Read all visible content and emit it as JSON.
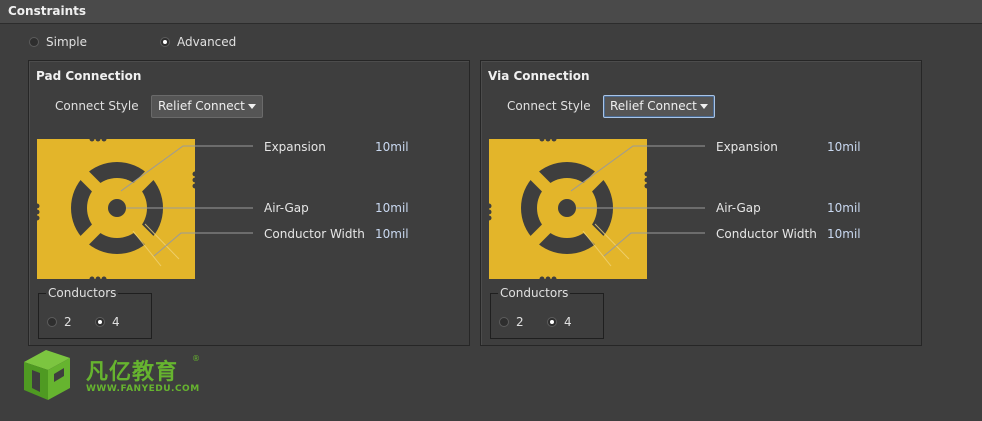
{
  "title": "Constraints",
  "mode": {
    "simple_label": "Simple",
    "advanced_label": "Advanced",
    "selected": "Advanced"
  },
  "pad": {
    "title": "Pad Connection",
    "connect_style_label": "Connect Style",
    "connect_style_value": "Relief Connect",
    "expansion_label": "Expansion",
    "expansion_value": "10mil",
    "airgap_label": "Air-Gap",
    "airgap_value": "10mil",
    "conductor_width_label": "Conductor Width",
    "conductor_width_value": "10mil",
    "conductors_label": "Conductors",
    "conductors_opt1": "2",
    "conductors_opt2": "4",
    "conductors_selected": "4"
  },
  "via": {
    "title": "Via Connection",
    "connect_style_label": "Connect Style",
    "connect_style_value": "Relief Connect",
    "expansion_label": "Expansion",
    "expansion_value": "10mil",
    "airgap_label": "Air-Gap",
    "airgap_value": "10mil",
    "conductor_width_label": "Conductor Width",
    "conductor_width_value": "10mil",
    "conductors_label": "Conductors",
    "conductors_opt1": "2",
    "conductors_opt2": "4",
    "conductors_selected": "4"
  },
  "watermark": {
    "brand_cn": "凡亿教育",
    "registered": "®",
    "url": "WWW.FANYEDU.COM"
  },
  "colors": {
    "copper": "#e3b52a",
    "background": "#3e3e3e",
    "brand_green": "#66b42f",
    "value_text": "#c9d8f0"
  }
}
